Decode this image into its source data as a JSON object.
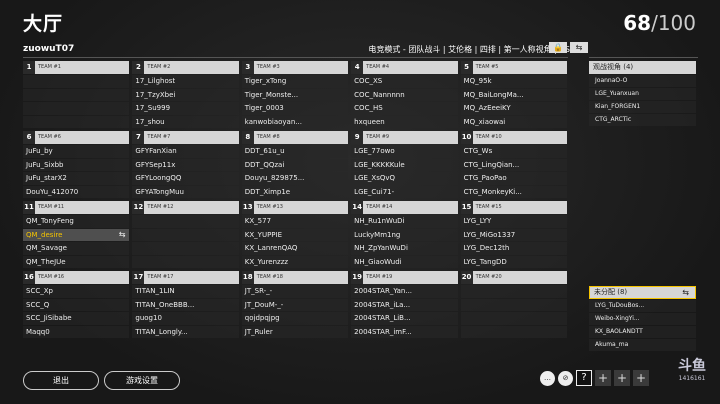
{
  "header": {
    "title": "大厅",
    "player_count": "68",
    "player_total": "/100",
    "username": "zuowuT07",
    "mode_text": "电竞模式 - 团队战斗 | 艾伦格 | 四排 | 第一人称视角 | AS",
    "lock_icon": "🔒",
    "swap_icon": "⇆"
  },
  "teams_rows": [
    [
      {
        "num": "1",
        "name": "TEAM #1",
        "players": [
          "",
          "",
          "",
          ""
        ]
      },
      {
        "num": "2",
        "name": "TEAM #2",
        "players": [
          "17_Lilghost",
          "17_TzyXbei",
          "17_Su999",
          "17_shou"
        ]
      },
      {
        "num": "3",
        "name": "TEAM #3",
        "players": [
          "Tiger_xTong",
          "Tiger_Monste...",
          "Tiger_0003",
          "kanwobiaoyan..."
        ]
      },
      {
        "num": "4",
        "name": "TEAM #4",
        "players": [
          "COC_XS",
          "COC_Nannnnn",
          "COC_HS",
          "hxqueen"
        ]
      },
      {
        "num": "5",
        "name": "TEAM #5",
        "players": [
          "MQ_95k",
          "MQ_BaiLongMa...",
          "MQ_AzEeeiKY",
          "MQ_xiaowai"
        ]
      }
    ],
    [
      {
        "num": "6",
        "name": "TEAM #6",
        "players": [
          "JuFu_by",
          "JuFu_Sixbb",
          "JuFu_starX2",
          "DouYu_412070"
        ]
      },
      {
        "num": "7",
        "name": "TEAM #7",
        "players": [
          "GFYFanXian",
          "GFYSep11x",
          "GFYLoongQQ",
          "GFYATongMuu"
        ]
      },
      {
        "num": "8",
        "name": "TEAM #8",
        "players": [
          "DDT_61u_u",
          "DDT_QQzai",
          "Douyu_829875...",
          "DDT_Ximp1e"
        ]
      },
      {
        "num": "9",
        "name": "TEAM #9",
        "players": [
          "LGE_77owo",
          "LGE_KKKKKule",
          "LGE_XsQvQ",
          "LGE_Cui71-"
        ]
      },
      {
        "num": "10",
        "name": "TEAM #10",
        "players": [
          "CTG_Ws",
          "CTG_LingQian...",
          "CTG_PaoPao",
          "CTG_MonkeyKi..."
        ]
      }
    ],
    [
      {
        "num": "11",
        "name": "TEAM #11",
        "players": [
          "QM_TonyFeng",
          "QM_desire",
          "QM_Savage",
          "QM_TheJUe"
        ],
        "highlight": 1
      },
      {
        "num": "12",
        "name": "TEAM #12",
        "players": [
          "",
          "",
          "",
          ""
        ]
      },
      {
        "num": "13",
        "name": "TEAM #13",
        "players": [
          "KX_577",
          "KX_YUPPIE",
          "KX_LanrenQAQ",
          "KX_Yurenzzz"
        ]
      },
      {
        "num": "14",
        "name": "TEAM #14",
        "players": [
          "NH_Ru1nWuDi",
          "LuckyMm1ng",
          "NH_ZpYanWuDi",
          "NH_GiaoWudi"
        ]
      },
      {
        "num": "15",
        "name": "TEAM #15",
        "players": [
          "LYG_LYY",
          "LYG_MiGo1337",
          "LYG_Dec12th",
          "LYG_TangDD"
        ]
      }
    ],
    [
      {
        "num": "16",
        "name": "TEAM #16",
        "players": [
          "SCC_Xp",
          "SCC_Q",
          "SCC_JiSibabe",
          "Maqq0"
        ]
      },
      {
        "num": "17",
        "name": "TEAM #17",
        "players": [
          "TITAN_1LIN",
          "TITAN_OneBBB...",
          "guog10",
          "TITAN_Longly..."
        ]
      },
      {
        "num": "18",
        "name": "TEAM #18",
        "players": [
          "JT_SR-_-",
          "JT_DouM-_-",
          "qojdpqjpg",
          "JT_Ruler"
        ]
      },
      {
        "num": "19",
        "name": "TEAM #19",
        "players": [
          "2004STAR_Yan...",
          "2004STAR_iLa...",
          "2004STAR_LiB...",
          "2004STAR_imF..."
        ]
      },
      {
        "num": "20",
        "name": "TEAM #20",
        "players": [
          "",
          "",
          "",
          ""
        ]
      }
    ]
  ],
  "spectators": {
    "title": "观战视角 (4)",
    "items": [
      "JoannaO-O",
      "LGE_Yuanxuan",
      "Kian_FORGEN1",
      "CTG_ARCTic"
    ]
  },
  "unassigned": {
    "title": "未分配 (8)",
    "items": [
      "LYG_TuDouBos...",
      "Weibo-XingYi...",
      "KX_BAOLANDTT",
      "Akuma_ma"
    ]
  },
  "footer": {
    "exit_label": "退出",
    "settings_label": "游戏设置",
    "q_label": "?",
    "plus": "+",
    "chat_icon": "…",
    "mute_icon": "⊘"
  },
  "watermark": {
    "logo": "斗鱼",
    "id": "1416161"
  }
}
